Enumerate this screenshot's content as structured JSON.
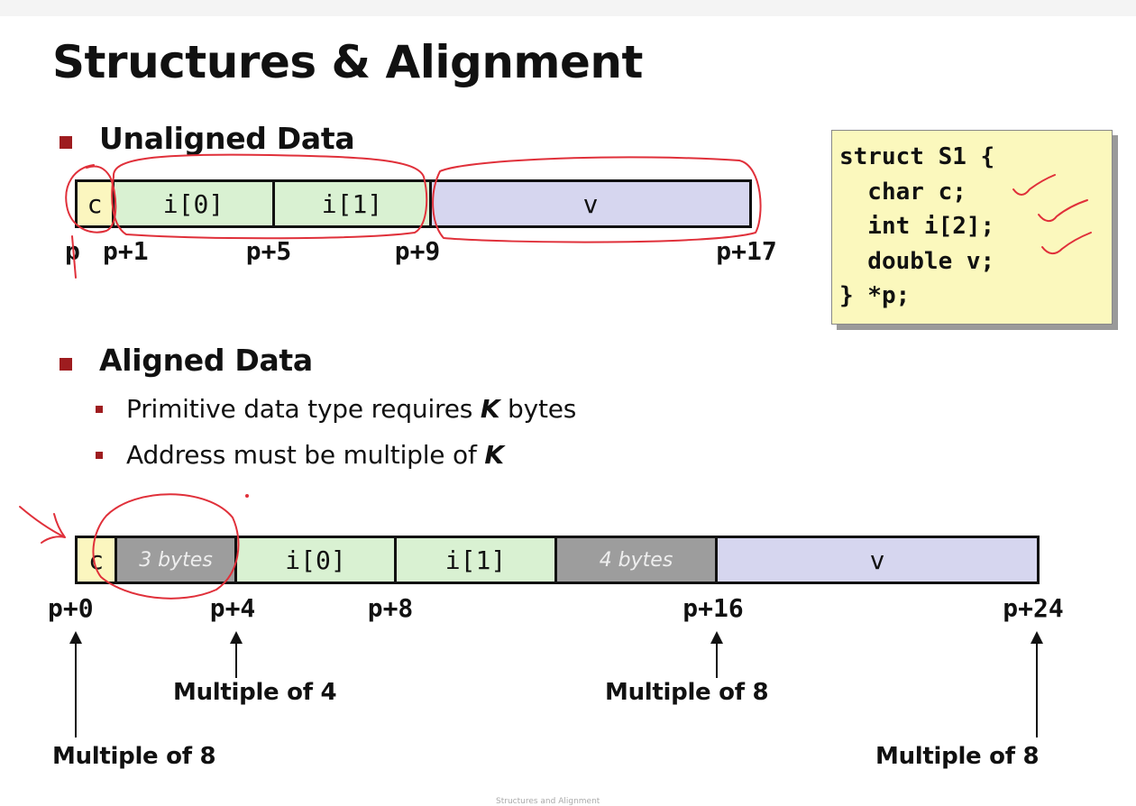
{
  "slide": {
    "title": "Structures & Alignment",
    "footer": "Structures and Alignment"
  },
  "unaligned": {
    "heading": "Unaligned Data",
    "cells": [
      "c",
      "i[0]",
      "i[1]",
      "v"
    ],
    "addresses": [
      "p",
      "p+1",
      "p+5",
      "p+9",
      "p+17"
    ]
  },
  "code": {
    "lines": [
      "struct S1 {",
      "  char c;",
      "  int i[2];",
      "  double v;",
      "} *p;"
    ]
  },
  "aligned": {
    "heading": "Aligned Data",
    "bullets": [
      {
        "text": "Primitive data type requires ",
        "emph": "K",
        "after": " bytes"
      },
      {
        "text": "Address must be multiple of ",
        "emph": "K",
        "after": ""
      }
    ],
    "cells": [
      "c",
      "3 bytes",
      "i[0]",
      "i[1]",
      "4 bytes",
      "v"
    ],
    "addresses": [
      "p+0",
      "p+4",
      "p+8",
      "p+16",
      "p+24"
    ],
    "notes": [
      "Multiple of 8",
      "Multiple of 4",
      "Multiple of 8",
      "Multiple of 8"
    ]
  },
  "colors": {
    "bullet": "#9e1c1f",
    "char_cell": "#fbf6bf",
    "int_cell": "#d9f1d2",
    "double_cell": "#d6d6ef",
    "padding_cell": "#9d9d9d",
    "code_box": "#fbf8bd",
    "annotation_ink": "#e0303a"
  }
}
